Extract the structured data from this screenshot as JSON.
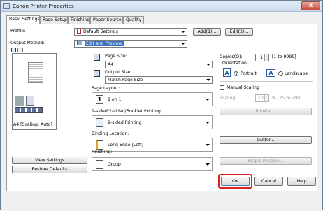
{
  "window": {
    "title": "Canon Printer Properties",
    "close_glyph": "x"
  },
  "tabs": [
    {
      "label": "Basic Settings"
    },
    {
      "label": "Page Setup"
    },
    {
      "label": "Finishing"
    },
    {
      "label": "Paper Source"
    },
    {
      "label": "Quality"
    }
  ],
  "profile": {
    "label": "Profile:",
    "value": "Default Settings",
    "add_button": "Add(1)...",
    "edit_button": "Edit(2)..."
  },
  "output_method": {
    "label": "Output Method:",
    "value": "Edit and Preview"
  },
  "preview": {
    "caption": "A4 [Scaling: Auto]"
  },
  "left_buttons": {
    "view_settings": "View Settings",
    "restore_defaults": "Restore Defaults"
  },
  "page_size": {
    "label": "Page Size:",
    "value": "A4"
  },
  "output_size": {
    "label": "Output Size:",
    "value": "Match Page Size"
  },
  "page_layout": {
    "label": "Page Layout:",
    "value": "1 on 1",
    "icon_digit": "1"
  },
  "printing_mode": {
    "label": "1-sided/2-sided/Booklet Printing:",
    "value": "2-sided Printing"
  },
  "binding_location": {
    "label": "Binding Location:",
    "value": "Long Edge [Left]"
  },
  "finishing": {
    "label": "Finishing:",
    "value": "Group"
  },
  "copies": {
    "label": "Copies(Q):",
    "value": "1",
    "range": "[1 to 9999]"
  },
  "orientation": {
    "label": "Orientation",
    "portrait": "Portrait",
    "landscape": "Landscape",
    "selected": "Portrait"
  },
  "manual_scaling": {
    "label": "Manual Scaling",
    "checked": false
  },
  "scaling": {
    "label": "Scaling:",
    "value": "100",
    "range": "% [25 to 200]"
  },
  "right_buttons": {
    "booklet": "Booklet...",
    "gutter": "Gutter...",
    "staple_position": "Staple Position..."
  },
  "dialog_buttons": {
    "ok": "OK",
    "cancel": "Cancel",
    "help": "Help"
  },
  "colors": {
    "accent": "#3b73c3",
    "highlight_box": "#e02020"
  }
}
